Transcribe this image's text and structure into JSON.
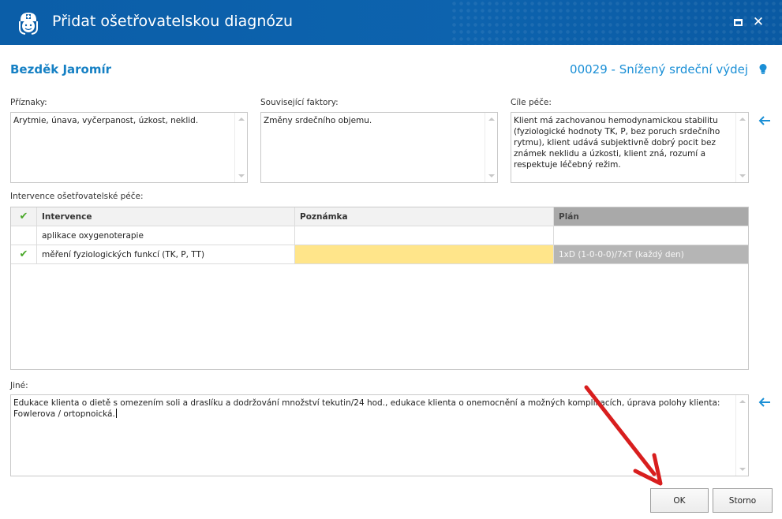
{
  "window": {
    "title": "Přidat ošetřovatelskou diagnózu",
    "icon": "nurse-icon",
    "controls": [
      "maximize-icon",
      "close-icon"
    ]
  },
  "header": {
    "patient_name": "Bezděk Jaromír",
    "diagnosis": "00029 - Snížený srdeční výdej",
    "hint_icon": "lightbulb-icon"
  },
  "fields": {
    "symptoms": {
      "label": "Příznaky:",
      "value": "Arytmie, únava, vyčerpanost, úzkost, neklid."
    },
    "factors": {
      "label": "Související faktory:",
      "value": "Změny srdečního objemu."
    },
    "goals": {
      "label": "Cíle péče:",
      "value": "Klient má zachovanou hemodynamickou stabilitu (fyziologické hodnoty TK, P, bez poruch srdečního rytmu), klient udává subjektivně dobrý pocit bez známek neklidu a úzkosti, klient zná, rozumí a respektuje léčebný režim."
    },
    "other": {
      "label": "Jiné:",
      "value": "Edukace klienta o dietě s omezením soli a draslíku a dodržování množství tekutin/24 hod., edukace klienta o onemocnění a možných komplikacích, úprava polohy klienta: Fowlerova / ortopnoická."
    }
  },
  "interventions": {
    "label": "Intervence ošetřovatelské péče:",
    "columns": [
      "Intervence",
      "Poznámka",
      "Plán"
    ],
    "rows": [
      {
        "checked": false,
        "name": "aplikace oxygenoterapie",
        "note": "",
        "plan": ""
      },
      {
        "checked": true,
        "name": "měření fyziologických funkcí (TK, P, TT)",
        "note": "",
        "plan": "1xD (1-0-0-0)/7xT (každý den)"
      }
    ]
  },
  "buttons": {
    "ok": "OK",
    "cancel": "Storno"
  },
  "colors": {
    "titlebar": "#0d63ae",
    "accent": "#1a8fd6",
    "check": "#4aa82a",
    "highlight": "#ffe58a",
    "plan_header": "#a9a9a9",
    "annotation_arrow": "#d81e1e"
  }
}
